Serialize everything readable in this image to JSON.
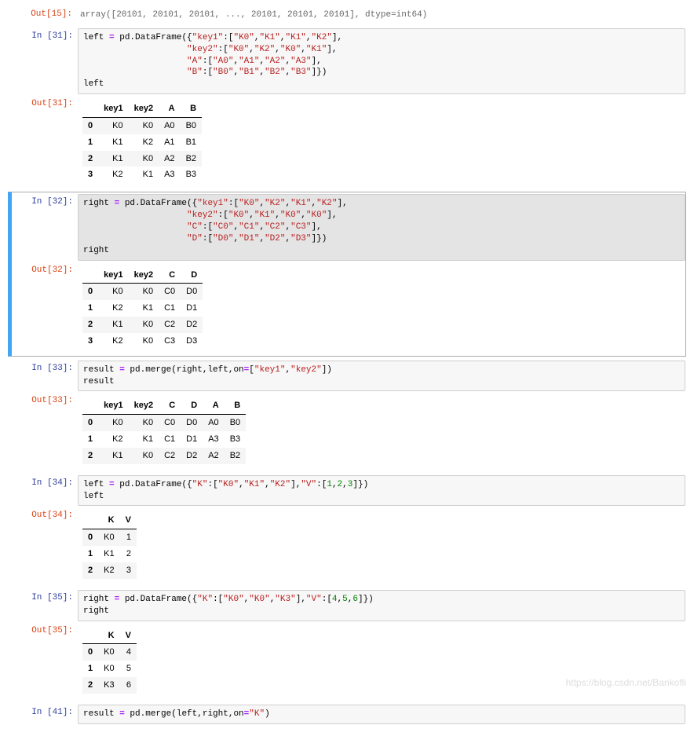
{
  "top": {
    "prompt": "Out[15]:",
    "text": "array([20101, 20101, 20101, ..., 20101, 20101, 20101], dtype=int64)"
  },
  "cells": [
    {
      "in_prompt": "In [31]:",
      "code_html": "left <span class='op'>=</span> pd.DataFrame({<span class='str'>\"key1\"</span>:[<span class='str'>\"K0\"</span>,<span class='str'>\"K1\"</span>,<span class='str'>\"K1\"</span>,<span class='str'>\"K2\"</span>],\n                    <span class='str'>\"key2\"</span>:[<span class='str'>\"K0\"</span>,<span class='str'>\"K2\"</span>,<span class='str'>\"K0\"</span>,<span class='str'>\"K1\"</span>],\n                    <span class='str'>\"A\"</span>:[<span class='str'>\"A0\"</span>,<span class='str'>\"A1\"</span>,<span class='str'>\"A2\"</span>,<span class='str'>\"A3\"</span>],\n                    <span class='str'>\"B\"</span>:[<span class='str'>\"B0\"</span>,<span class='str'>\"B1\"</span>,<span class='str'>\"B2\"</span>,<span class='str'>\"B3\"</span>]})\nleft",
      "out_prompt": "Out[31]:",
      "table": {
        "headers": [
          "",
          "key1",
          "key2",
          "A",
          "B"
        ],
        "rows": [
          [
            "0",
            "K0",
            "K0",
            "A0",
            "B0"
          ],
          [
            "1",
            "K1",
            "K2",
            "A1",
            "B1"
          ],
          [
            "2",
            "K1",
            "K0",
            "A2",
            "B2"
          ],
          [
            "3",
            "K2",
            "K1",
            "A3",
            "B3"
          ]
        ]
      },
      "selected": false
    },
    {
      "in_prompt": "In [32]:",
      "code_html": "right <span class='op'>=</span> pd.DataFrame({<span class='str'>\"key1\"</span>:[<span class='str'>\"K0\"</span>,<span class='str'>\"K2\"</span>,<span class='str'>\"K1\"</span>,<span class='str'>\"K2\"</span>],\n                    <span class='str'>\"key2\"</span>:[<span class='str'>\"K0\"</span>,<span class='str'>\"K1\"</span>,<span class='str'>\"K0\"</span>,<span class='str'>\"K0\"</span>],\n                    <span class='str'>\"C\"</span>:[<span class='str'>\"C0\"</span>,<span class='str'>\"C1\"</span>,<span class='str'>\"C2\"</span>,<span class='str'>\"C3\"</span>],\n                    <span class='str'>\"D\"</span>:[<span class='str'>\"D0\"</span>,<span class='str'>\"D1\"</span>,<span class='str'>\"D2\"</span>,<span class='str'>\"D3\"</span>]})\nright",
      "out_prompt": "Out[32]:",
      "table": {
        "headers": [
          "",
          "key1",
          "key2",
          "C",
          "D"
        ],
        "rows": [
          [
            "0",
            "K0",
            "K0",
            "C0",
            "D0"
          ],
          [
            "1",
            "K2",
            "K1",
            "C1",
            "D1"
          ],
          [
            "2",
            "K1",
            "K0",
            "C2",
            "D2"
          ],
          [
            "3",
            "K2",
            "K0",
            "C3",
            "D3"
          ]
        ]
      },
      "selected": true
    },
    {
      "in_prompt": "In [33]:",
      "code_html": "result <span class='op'>=</span> pd.merge(right,left,on<span class='op'>=</span>[<span class='str'>\"key1\"</span>,<span class='str'>\"key2\"</span>])\nresult",
      "out_prompt": "Out[33]:",
      "table": {
        "headers": [
          "",
          "key1",
          "key2",
          "C",
          "D",
          "A",
          "B"
        ],
        "rows": [
          [
            "0",
            "K0",
            "K0",
            "C0",
            "D0",
            "A0",
            "B0"
          ],
          [
            "1",
            "K2",
            "K1",
            "C1",
            "D1",
            "A3",
            "B3"
          ],
          [
            "2",
            "K1",
            "K0",
            "C2",
            "D2",
            "A2",
            "B2"
          ]
        ]
      },
      "selected": false
    },
    {
      "in_prompt": "In [34]:",
      "code_html": "left <span class='op'>=</span> pd.DataFrame({<span class='str'>\"K\"</span>:[<span class='str'>\"K0\"</span>,<span class='str'>\"K1\"</span>,<span class='str'>\"K2\"</span>],<span class='str'>\"V\"</span>:[<span class='num'>1</span>,<span class='num'>2</span>,<span class='num'>3</span>]})\nleft",
      "out_prompt": "Out[34]:",
      "table": {
        "headers": [
          "",
          "K",
          "V"
        ],
        "rows": [
          [
            "0",
            "K0",
            "1"
          ],
          [
            "1",
            "K1",
            "2"
          ],
          [
            "2",
            "K2",
            "3"
          ]
        ]
      },
      "selected": false
    },
    {
      "in_prompt": "In [35]:",
      "code_html": "right <span class='op'>=</span> pd.DataFrame({<span class='str'>\"K\"</span>:[<span class='str'>\"K0\"</span>,<span class='str'>\"K0\"</span>,<span class='str'>\"K3\"</span>],<span class='str'>\"V\"</span>:[<span class='num'>4</span>,<span class='num'>5</span>,<span class='num'>6</span>]})\nright",
      "out_prompt": "Out[35]:",
      "table": {
        "headers": [
          "",
          "K",
          "V"
        ],
        "rows": [
          [
            "0",
            "K0",
            "4"
          ],
          [
            "1",
            "K0",
            "5"
          ],
          [
            "2",
            "K3",
            "6"
          ]
        ]
      },
      "selected": false
    },
    {
      "in_prompt": "In [41]:",
      "code_html": "result <span class='op'>=</span> pd.merge(left,right,on<span class='op'>=</span><span class='str'>\"K\"</span>)",
      "out_prompt": "",
      "table": null,
      "selected": false
    }
  ],
  "watermark": "https://blog.csdn.net/Bankofli"
}
